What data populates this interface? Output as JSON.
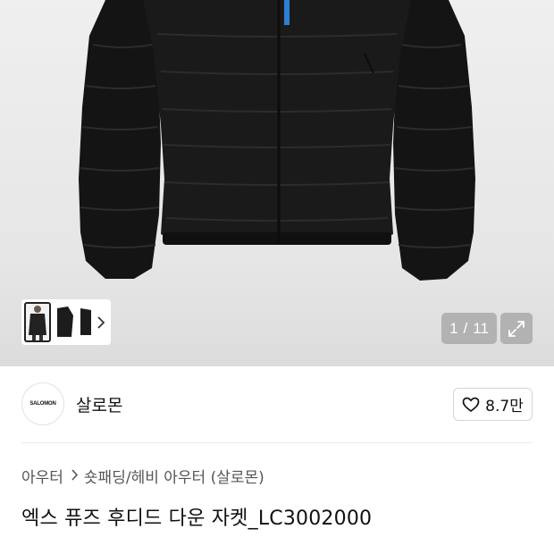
{
  "gallery": {
    "current": "1",
    "separator": "/",
    "total": "11",
    "expand_icon": "expand-icon",
    "thumb_next_icon": "chevron-right-icon"
  },
  "brand": {
    "logo_text": "SALOMON",
    "name": "살로몬"
  },
  "like": {
    "icon": "heart-icon",
    "count": "8.7만"
  },
  "breadcrumb": {
    "items": [
      "아우터",
      "숏패딩/헤비 아우터 (살로몬)"
    ]
  },
  "product": {
    "title": "엑스 퓨즈 후디드 다운 자켓_LC3002000"
  },
  "colors": {
    "hero_bg": "#e8e8e8",
    "jacket": "#151515",
    "zip_accent": "#2f7fd6"
  }
}
